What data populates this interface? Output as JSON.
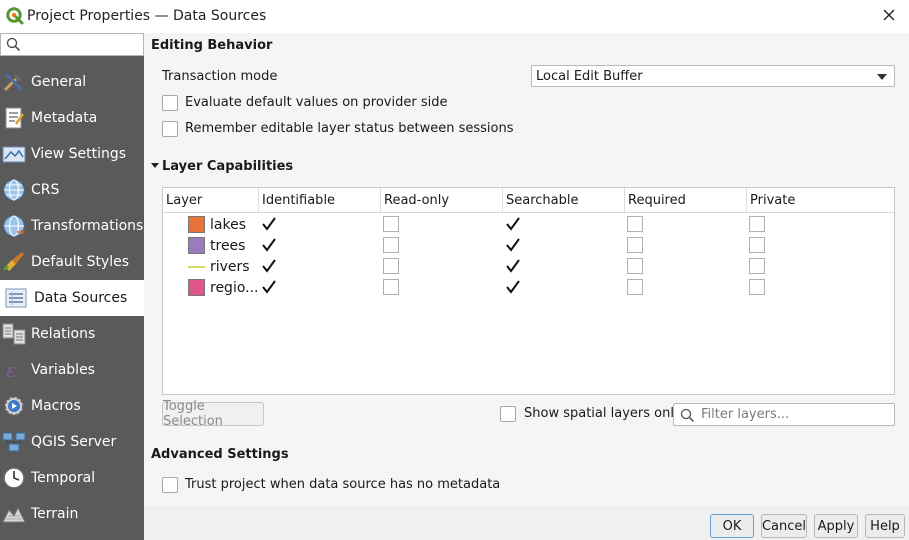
{
  "window": {
    "title": "Project Properties — Data Sources"
  },
  "sidebar": {
    "search_value": "",
    "items": [
      {
        "label": "General",
        "icon": "tools-icon"
      },
      {
        "label": "Metadata",
        "icon": "metadata-icon"
      },
      {
        "label": "View Settings",
        "icon": "view-settings-icon"
      },
      {
        "label": "CRS",
        "icon": "globe-icon"
      },
      {
        "label": "Transformations",
        "icon": "transform-globe-icon"
      },
      {
        "label": "Default Styles",
        "icon": "paintbrush-icon"
      },
      {
        "label": "Data Sources",
        "icon": "data-sources-icon",
        "active": true
      },
      {
        "label": "Relations",
        "icon": "relations-icon"
      },
      {
        "label": "Variables",
        "icon": "variables-icon"
      },
      {
        "label": "Macros",
        "icon": "macros-icon"
      },
      {
        "label": "QGIS Server",
        "icon": "server-icon"
      },
      {
        "label": "Temporal",
        "icon": "clock-icon"
      },
      {
        "label": "Terrain",
        "icon": "terrain-icon"
      }
    ]
  },
  "editing": {
    "heading": "Editing Behavior",
    "transaction_label": "Transaction mode",
    "transaction_value": "Local Edit Buffer",
    "eval_defaults_label": "Evaluate default values on provider side",
    "remember_label": "Remember editable layer status between sessions"
  },
  "capabilities": {
    "heading": "Layer Capabilities",
    "columns": [
      "Layer",
      "Identifiable",
      "Read-only",
      "Searchable",
      "Required",
      "Private"
    ],
    "layers": [
      {
        "name": "lakes",
        "color": "#e8733a",
        "kind": "polygon",
        "identifiable": true,
        "readonly": false,
        "searchable": true,
        "required": false,
        "private": false
      },
      {
        "name": "trees",
        "color": "#9b7bc0",
        "kind": "polygon",
        "identifiable": true,
        "readonly": false,
        "searchable": true,
        "required": false,
        "private": false
      },
      {
        "name": "rivers",
        "color": "#d6d86a",
        "kind": "line",
        "identifiable": true,
        "readonly": false,
        "searchable": true,
        "required": false,
        "private": false
      },
      {
        "name": "regio...",
        "color": "#e0558a",
        "kind": "polygon",
        "identifiable": true,
        "readonly": false,
        "searchable": true,
        "required": false,
        "private": false
      }
    ],
    "toggle_button": "Toggle Selection",
    "spatial_only_label": "Show spatial layers only",
    "filter_placeholder": "Filter layers..."
  },
  "advanced": {
    "heading": "Advanced Settings",
    "trust_label": "Trust project when data source has no metadata"
  },
  "footer": {
    "ok": "OK",
    "cancel": "Cancel",
    "apply": "Apply",
    "help": "Help"
  }
}
